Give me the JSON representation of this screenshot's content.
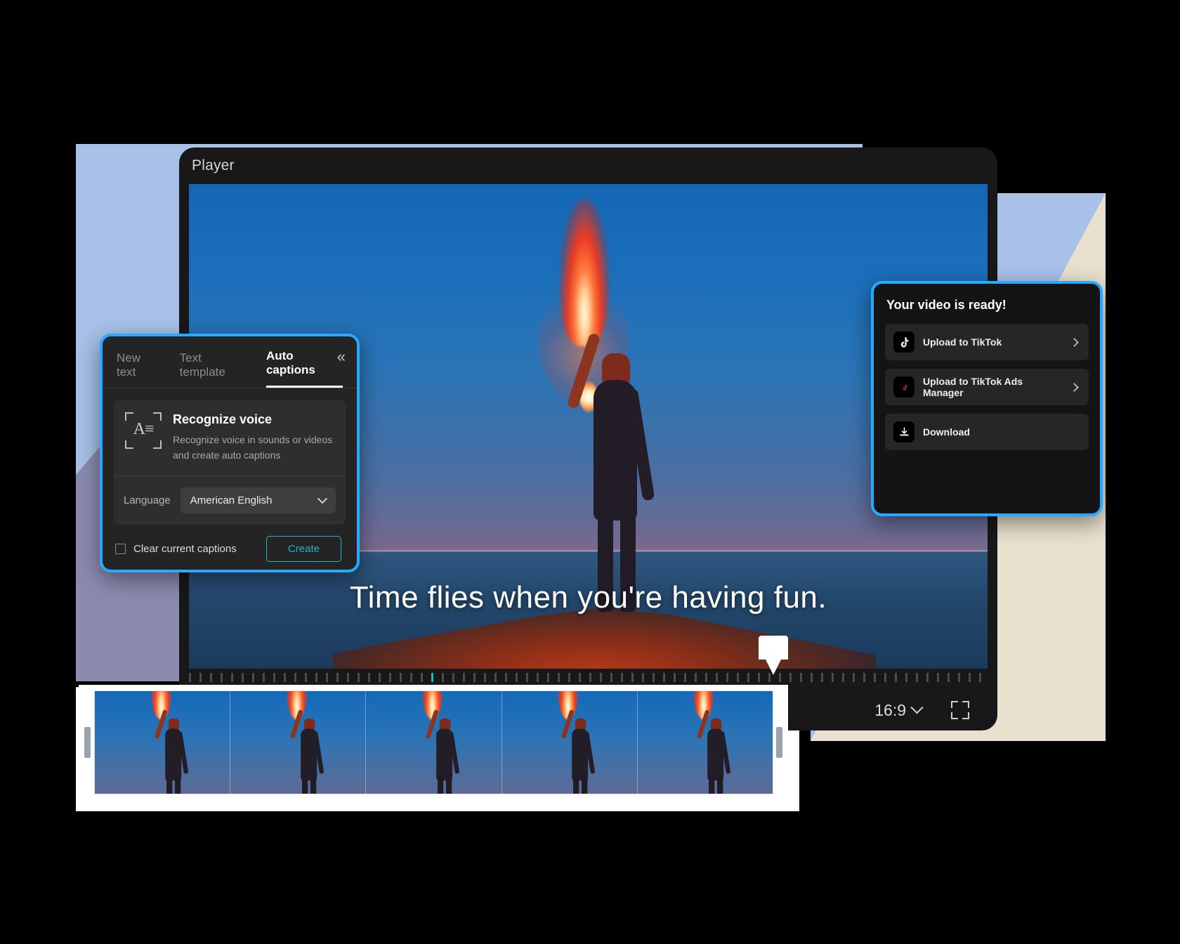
{
  "editor": {
    "title": "Player",
    "caption_text": "Time flies when you're having fun.",
    "aspect_ratio": "16:9",
    "aspect_chevron_icon": "chevron-down-icon",
    "fullscreen_icon": "expand-icon"
  },
  "captions_panel": {
    "tabs": [
      {
        "label": "New text",
        "active": false
      },
      {
        "label": "Text template",
        "active": false
      },
      {
        "label": "Auto captions",
        "active": true
      }
    ],
    "collapse_icon": "double-chevron-left-icon",
    "recognize": {
      "icon": "text-recognition-icon",
      "title": "Recognize voice",
      "description": "Recognize voice in sounds or videos and create auto captions"
    },
    "language_label": "Language",
    "language_value": "American English",
    "language_chevron_icon": "chevron-down-icon",
    "clear_captions_label": "Clear current captions",
    "clear_captions_checked": false,
    "create_label": "Create"
  },
  "ready_panel": {
    "title": "Your video is ready!",
    "items": [
      {
        "label": "Upload to TikTok",
        "icon": "tiktok-icon",
        "arrow": "chevron-right-icon",
        "has_arrow": true
      },
      {
        "label": "Upload to TikTok Ads Manager",
        "icon": "tiktok-ads-manager-icon",
        "arrow": "chevron-right-icon",
        "has_arrow": true
      },
      {
        "label": "Download",
        "icon": "download-icon",
        "arrow": "",
        "has_arrow": false
      }
    ]
  },
  "timeline": {
    "frame_count": 5,
    "left_handle": "trim-handle-left",
    "right_handle": "trim-handle-right",
    "playhead": "playhead-marker"
  },
  "colors": {
    "accent_blue": "#29a8ff",
    "accent_teal": "#1fb8c6",
    "panel_bg": "#242424",
    "ready_bg": "#141414",
    "editor_bg": "#181818",
    "bg_light_blue": "#a8c1e8",
    "bg_cream": "#e9e1cf",
    "bg_purple": "#8b8bb0"
  }
}
